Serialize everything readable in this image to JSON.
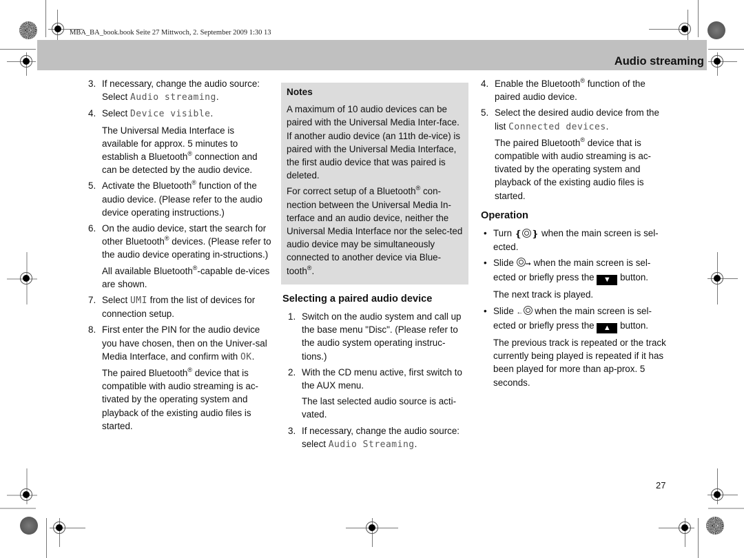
{
  "print_header": {
    "book_line": "MBA_BA_book.book  Seite 27  Mittwoch, 2. September 2009  1:30 13"
  },
  "section_title": "Audio streaming",
  "column1": {
    "items": [
      {
        "num": "3.",
        "pre": "If necessary, change the audio source: Select ",
        "code": "Audio streaming",
        "post": "."
      },
      {
        "num": "4.",
        "pre": "Select ",
        "code": "Device visible",
        "post": "."
      }
    ],
    "item4_note": "The Universal Media Interface is available for approx. 5 minutes to establish a Bluetooth",
    "item4_note_tail": " connection and can be detected by the audio device.",
    "item5": {
      "num": "5.",
      "pre": "Activate the Bluetooth",
      "post": " function of the audio device. (Please refer to the audio device operating instructions.)"
    },
    "item6": {
      "num": "6.",
      "pre": "On the audio device, start the search for other Bluetooth",
      "post": " devices. (Please refer to the audio device operating in-structions.)"
    },
    "item6_note_pre": "All available Bluetooth",
    "item6_note_post": "-capable de-vices are shown.",
    "item7": {
      "num": "7.",
      "pre": "Select ",
      "code": "UMI",
      "post": " from the list of devices for connection setup."
    },
    "item8": {
      "num": "8.",
      "pre": "First enter the PIN for the audio device you have chosen, then on the Univer-sal Media Interface, and confirm with ",
      "code": "OK",
      "post": "."
    },
    "item8_note_pre": "The paired Bluetooth",
    "item8_note_post": " device that is compatible with audio streaming is ac-tivated by the operating system and playback of the existing audio files is started."
  },
  "registered_mark": "®",
  "notes": {
    "title": "Notes",
    "p1": "A maximum of 10 audio devices can be paired with the Universal Media Inter-face. If another audio device (an 11th de-vice) is paired with the Universal Media Interface, the first audio device that was paired is deleted.",
    "p2_pre": "For correct setup of a Bluetooth",
    "p2_post": " con-nection between the Universal Media In-terface and an audio device, neither the Universal Media Interface nor the selec-ted audio device may be simultaneously connected to another device via Blue-tooth",
    "p2_end": "."
  },
  "selecting": {
    "heading": "Selecting a paired audio device",
    "item1": {
      "num": "1.",
      "text": "Switch on the audio system and call up the base menu \"Disc\". (Please refer to the audio system operating instruc-tions.)"
    },
    "item2": {
      "num": "2.",
      "text": "With the CD menu active, first switch to the AUX menu."
    },
    "item2_note": "The last selected audio source is acti-vated.",
    "item3": {
      "num": "3.",
      "pre": "If necessary, change the audio source: select ",
      "code": "Audio Streaming",
      "post": "."
    },
    "item4": {
      "num": "4.",
      "pre": "Enable the Bluetooth",
      "post": " function of the paired audio device."
    },
    "item5": {
      "num": "5.",
      "pre": "Select the desired audio device from the list ",
      "code": "Connected devices",
      "post": "."
    },
    "item5_note_pre": "The paired Bluetooth",
    "item5_note_post": " device that is compatible with audio streaming is ac-tivated by the operating system and playback of the existing audio files is started."
  },
  "operation": {
    "heading": "Operation",
    "bullet_char": "•",
    "b1_pre": "Turn ",
    "b1_post": " when the main screen is sel-ected.",
    "b2_pre": "Slide ",
    "b2_mid": " when the main screen is sel-ected or briefly press the ",
    "b2_key": "▼",
    "b2_post": " button.",
    "b2_note": "The next track is played.",
    "b3_pre": "Slide ",
    "b3_mid": " when the main screen is sel-ected or briefly press the ",
    "b3_key": "▲",
    "b3_post": " button.",
    "b3_note": "The previous track is repeated or the track currently being played is repeated if it has been played for more than ap-prox. 5 seconds.",
    "arrow_right": "➞",
    "arrow_left": "←",
    "rotate_left": "❴",
    "rotate_right": "❵"
  },
  "page_number": "27"
}
